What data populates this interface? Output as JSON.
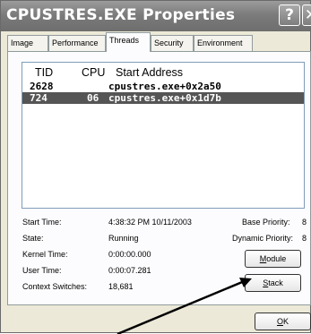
{
  "window": {
    "title": "CPUSTRES.EXE Properties",
    "help_glyph": "?",
    "close_glyph": "✕"
  },
  "tabs": [
    {
      "label": "Image"
    },
    {
      "label": "Performance"
    },
    {
      "label": "Threads"
    },
    {
      "label": "Security"
    },
    {
      "label": "Environment"
    }
  ],
  "thread_list": {
    "columns": [
      "TID",
      "CPU",
      "Start Address"
    ],
    "rows": [
      {
        "tid": "2628",
        "cpu": "",
        "start_address": "cpustres.exe+0x2a50",
        "selected": false
      },
      {
        "tid": "724",
        "cpu": "06",
        "start_address": "cpustres.exe+0x1d7b",
        "selected": true
      }
    ]
  },
  "details": {
    "start_time_label": "Start Time:",
    "start_time_value": "4:38:32 PM   10/11/2003",
    "state_label": "State:",
    "state_value": "Running",
    "kernel_time_label": "Kernel Time:",
    "kernel_time_value": "0:00:00.000",
    "user_time_label": "User Time:",
    "user_time_value": "0:00:07.281",
    "context_switches_label": "Context Switches:",
    "context_switches_value": "18,681",
    "base_priority_label": "Base Priority:",
    "base_priority_value": "8",
    "dynamic_priority_label": "Dynamic Priority:",
    "dynamic_priority_value": "8"
  },
  "buttons": {
    "module_first": "M",
    "module_rest": "odule",
    "stack_first": "S",
    "stack_rest": "tack",
    "ok_first": "O",
    "ok_rest": "K"
  },
  "colors": {
    "titlebar": "#7b7b7b",
    "selection": "#555555",
    "dialog_face": "#ece9d8"
  }
}
